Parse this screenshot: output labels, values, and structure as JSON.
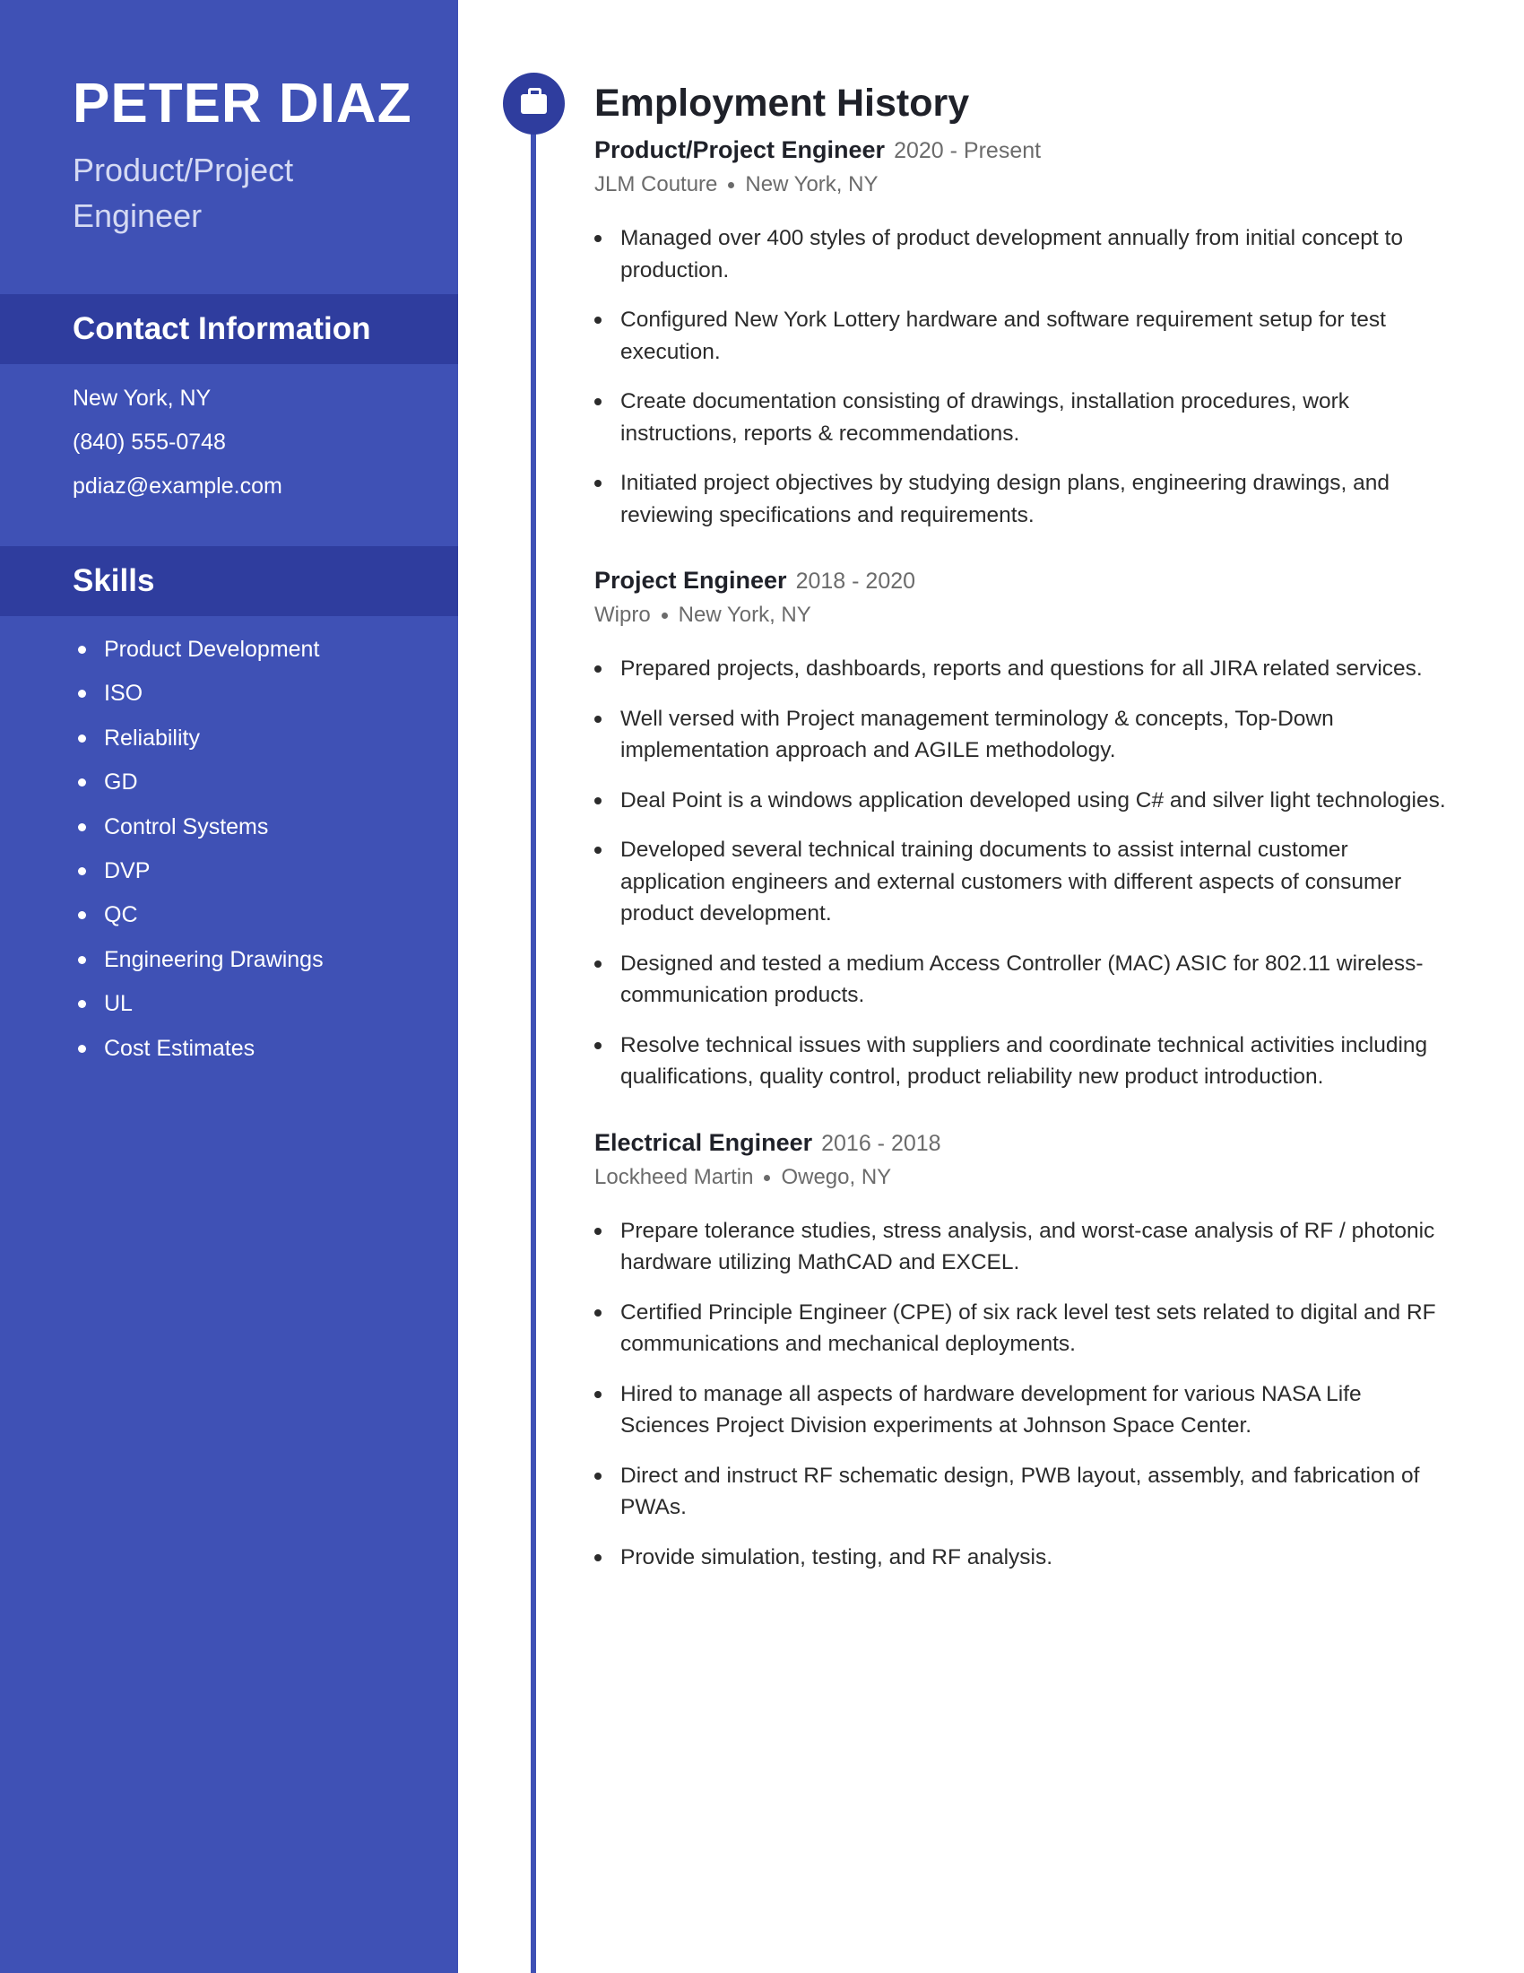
{
  "profile": {
    "name": "PETER DIAZ",
    "role": "Product/Project Engineer"
  },
  "contact": {
    "heading": "Contact Information",
    "items": [
      "New York, NY",
      "(840) 555-0748",
      "pdiaz@example.com"
    ]
  },
  "skills": {
    "heading": "Skills",
    "items": [
      "Product Development",
      "ISO",
      "Reliability",
      "GD",
      "Control Systems",
      "DVP",
      "QC",
      "Engineering Drawings",
      "UL",
      "Cost Estimates"
    ]
  },
  "employment": {
    "heading": "Employment History",
    "icon": "briefcase-icon",
    "jobs": [
      {
        "title": "Product/Project Engineer",
        "dates": "2020 - Present",
        "company": "JLM Couture",
        "location": "New York, NY",
        "bullets": [
          "Managed over 400 styles of product development annually from initial concept to production.",
          "Configured New York Lottery hardware and software requirement setup for test execution.",
          "Create documentation consisting of drawings, installation procedures, work instructions, reports & recommendations.",
          "Initiated project objectives by studying design plans, engineering drawings, and reviewing specifications and requirements."
        ]
      },
      {
        "title": "Project Engineer",
        "dates": "2018 - 2020",
        "company": "Wipro",
        "location": "New York, NY",
        "bullets": [
          "Prepared projects, dashboards, reports and questions for all JIRA related services.",
          "Well versed with Project management terminology & concepts, Top-Down implementation approach and AGILE methodology.",
          "Deal Point is a windows application developed using C# and silver light technologies.",
          "Developed several technical training documents to assist internal customer application engineers and external customers with different aspects of consumer product development.",
          "Designed and tested a medium Access Controller (MAC) ASIC for 802.11 wireless-communication products.",
          "Resolve technical issues with suppliers and coordinate technical activities including qualifications, quality control, product reliability new product introduction."
        ]
      },
      {
        "title": "Electrical Engineer",
        "dates": "2016 - 2018",
        "company": "Lockheed Martin",
        "location": "Owego, NY",
        "bullets": [
          "Prepare tolerance studies, stress analysis, and worst-case analysis of RF / photonic hardware utilizing MathCAD and EXCEL.",
          "Certified Principle Engineer (CPE) of six rack level test sets related to digital and RF communications and mechanical deployments.",
          "Hired to manage all aspects of hardware development for various NASA Life Sciences Project Division experiments at Johnson Space Center.",
          "Direct and instruct RF schematic design, PWB layout, assembly, and fabrication of PWAs.",
          "Provide simulation, testing, and RF analysis."
        ]
      }
    ]
  },
  "colors": {
    "sidebar": "#3f51b5",
    "section_band": "#2f3d9e",
    "accent": "#3f51b5",
    "text": "#2b2b2b",
    "muted": "#6b6b6b"
  }
}
